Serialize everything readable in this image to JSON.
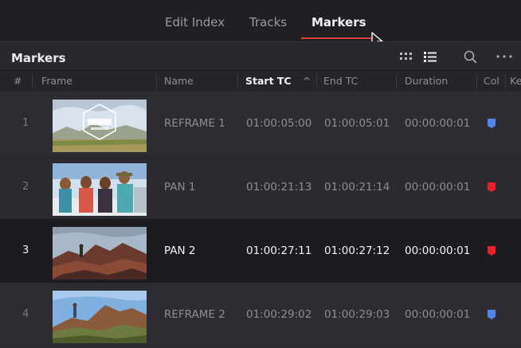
{
  "tabs": [
    {
      "label": "Edit Index",
      "active": false
    },
    {
      "label": "Tracks",
      "active": false
    },
    {
      "label": "Markers",
      "active": true
    }
  ],
  "panel": {
    "title": "Markers"
  },
  "toolbar_icons": [
    "grid-view-icon",
    "list-view-icon",
    "search-icon",
    "more-options-icon"
  ],
  "columns": [
    "#",
    "Frame",
    "Name",
    "Start TC",
    "End TC",
    "Duration",
    "Col",
    "Ke"
  ],
  "sort": {
    "column": "Start TC",
    "direction": "ascending"
  },
  "colors": {
    "blue": "#4f86e8",
    "red": "#e8202a",
    "accent": "#d9413e"
  },
  "rows": [
    {
      "num": "1",
      "name": "REFRAME 1",
      "start": "01:00:05:00",
      "end": "01:00:05:01",
      "duration": "00:00:00:01",
      "color": "blue",
      "selected": false
    },
    {
      "num": "2",
      "name": "PAN 1",
      "start": "01:00:21:13",
      "end": "01:00:21:14",
      "duration": "00:00:00:01",
      "color": "red",
      "selected": false
    },
    {
      "num": "3",
      "name": "PAN 2",
      "start": "01:00:27:11",
      "end": "01:00:27:12",
      "duration": "00:00:00:01",
      "color": "red",
      "selected": true
    },
    {
      "num": "4",
      "name": "REFRAME 2",
      "start": "01:00:29:02",
      "end": "01:00:29:03",
      "duration": "00:00:00:01",
      "color": "blue",
      "selected": false
    }
  ]
}
